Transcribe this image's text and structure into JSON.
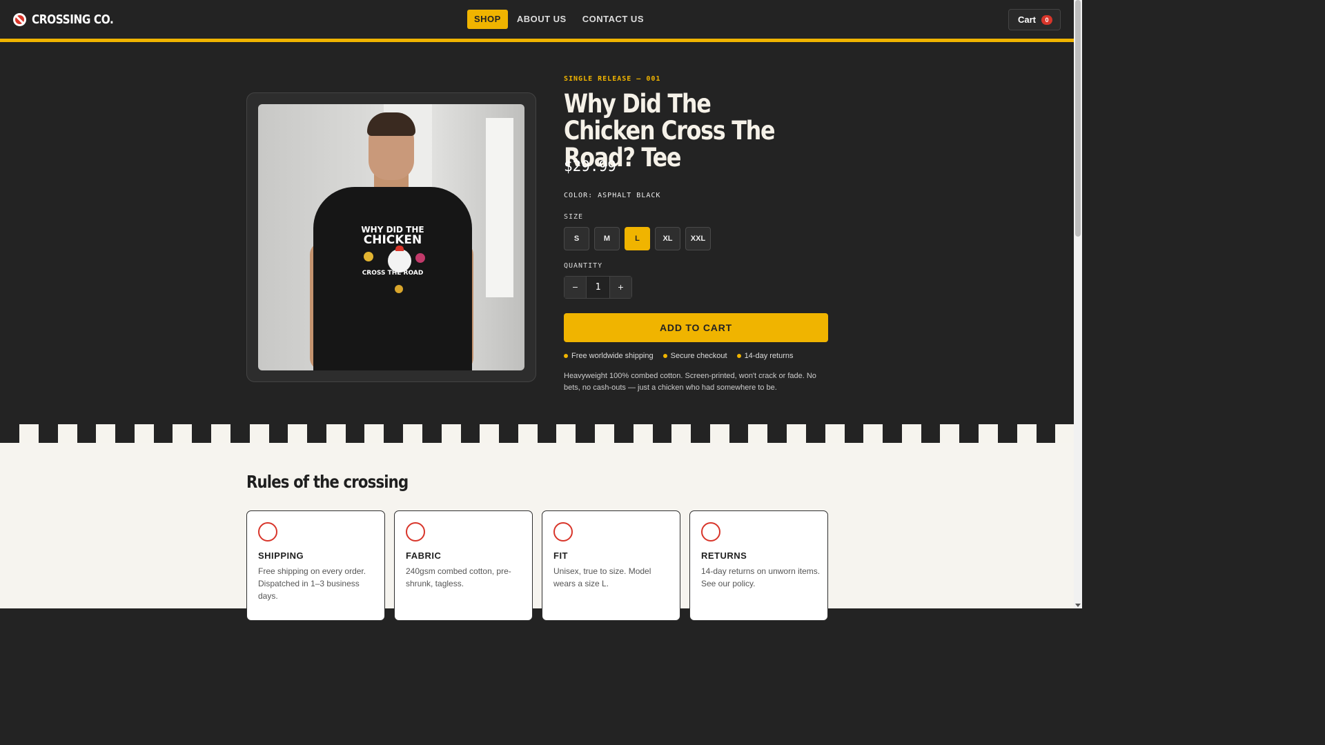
{
  "brand": {
    "name": "CROSSING CO.",
    "icon": "no-crossing-icon"
  },
  "nav": {
    "items": [
      {
        "label": "SHOP"
      },
      {
        "label": "ABOUT US"
      },
      {
        "label": "CONTACT US"
      }
    ]
  },
  "cart": {
    "label": "Cart",
    "count": "0"
  },
  "product": {
    "eyebrow": "SINGLE RELEASE — 001",
    "title": "Why Did The Chicken Cross The Road? Tee",
    "price": "$29.99",
    "color_line": "COLOR: ASPHALT BLACK",
    "size_label": "SIZE",
    "sizes": [
      "S",
      "M",
      "L",
      "XL",
      "XXL"
    ],
    "selected_size": "L",
    "quantity_label": "QUANTITY",
    "quantity": "1",
    "qty_minus": "−",
    "qty_plus": "+",
    "add_to_cart": "ADD TO CART",
    "perks": [
      "Free worldwide shipping",
      "Secure checkout",
      "14-day returns"
    ],
    "description": "Heavyweight 100% combed cotton. Screen-printed, won't crack or fade. No bets, no cash-outs — just a chicken who had somewhere to be.",
    "image_print": {
      "line1": "WHY DID THE",
      "line2": "CHICKEN",
      "line3": "CROSS THE ROAD"
    }
  },
  "rules": {
    "title": "Rules of the crossing",
    "cards": [
      {
        "title": "SHIPPING",
        "text": "Free shipping on every order. Dispatched in 1–3 business days."
      },
      {
        "title": "FABRIC",
        "text": "240gsm combed cotton, pre-shrunk, tagless."
      },
      {
        "title": "FIT",
        "text": "Unisex, true to size. Model wears a size L."
      },
      {
        "title": "RETURNS",
        "text": "14-day returns on unworn items. See our policy."
      }
    ]
  },
  "colors": {
    "accent": "#f0b400",
    "dark": "#232323",
    "red": "#d8352a",
    "light": "#f6f4ef"
  }
}
